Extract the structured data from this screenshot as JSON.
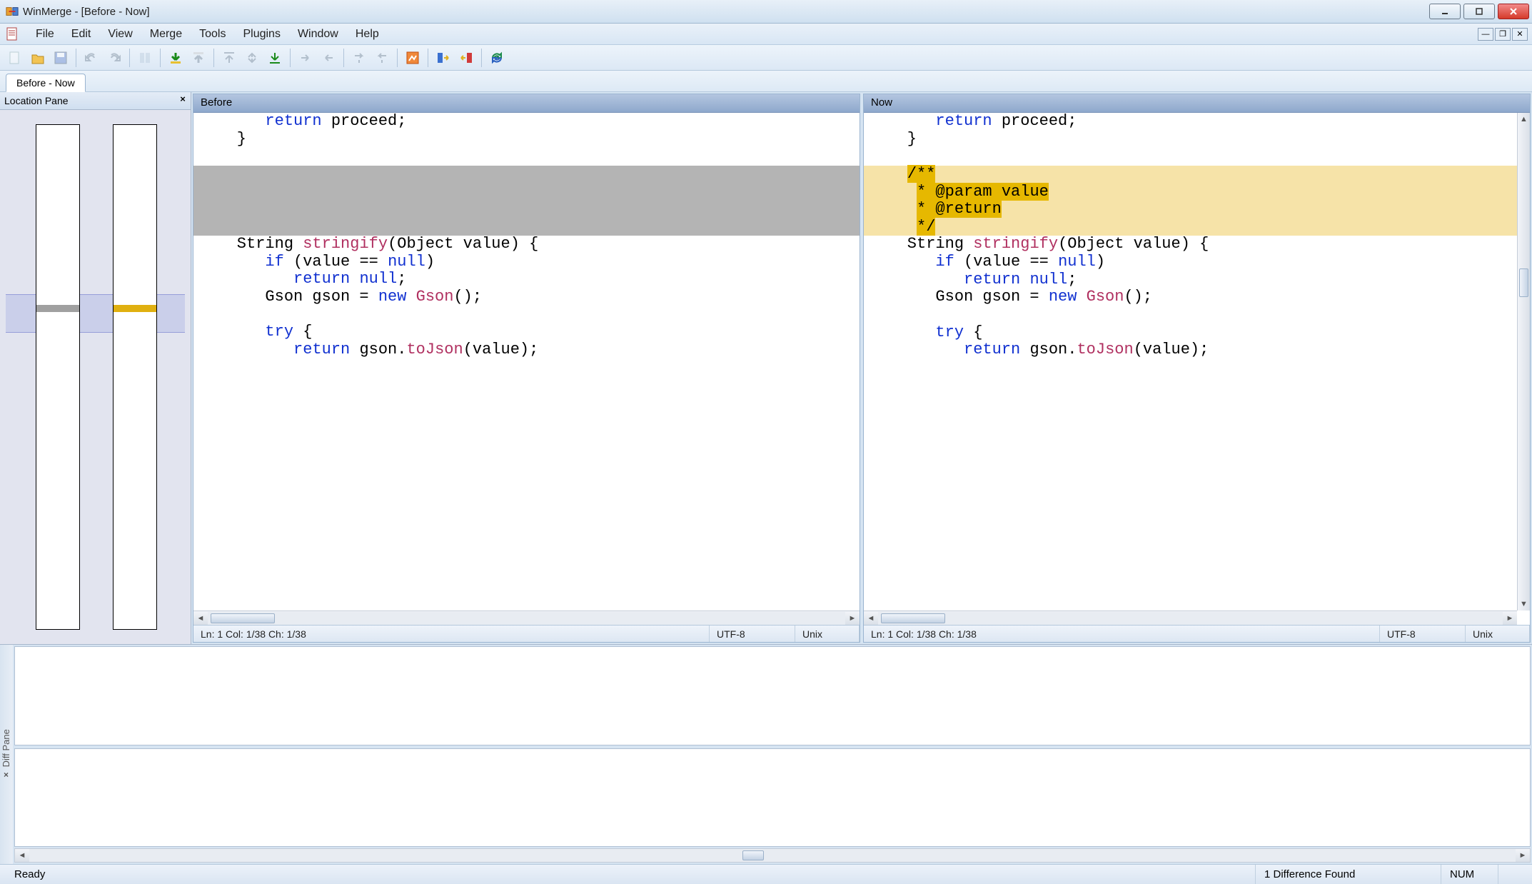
{
  "titlebar": {
    "text": "WinMerge - [Before - Now]"
  },
  "menu": {
    "file": "File",
    "edit": "Edit",
    "view": "View",
    "merge": "Merge",
    "tools": "Tools",
    "plugins": "Plugins",
    "window": "Window",
    "help": "Help"
  },
  "tabs": {
    "active": "Before - Now"
  },
  "location_pane": {
    "title": "Location Pane"
  },
  "panes": {
    "left": {
      "title": "Before",
      "status_pos": "Ln: 1  Col: 1/38  Ch: 1/38",
      "status_enc": "UTF-8",
      "status_eol": "Unix"
    },
    "right": {
      "title": "Now",
      "status_pos": "Ln: 1  Col: 1/38  Ch: 1/38",
      "status_enc": "UTF-8",
      "status_eol": "Unix"
    }
  },
  "code": {
    "common_top_l1": "       return proceed;",
    "common_top_l2": "    }",
    "added_l1": "    /**",
    "added_l2": "     * @param value",
    "added_l3": "     * @return",
    "added_l4": "     */",
    "sig": "    String stringify(Object value) {",
    "if_line": "       if (value == null)",
    "ret_null": "          return null;",
    "gson_line": "       Gson gson = new Gson();",
    "blank": "",
    "try_line": "       try {",
    "cut_line": "          return gson.toJson(value);"
  },
  "diff_pane": {
    "label": "Diff Pane"
  },
  "statusbar": {
    "ready": "Ready",
    "diffcount": "1 Difference Found",
    "num": "NUM"
  }
}
